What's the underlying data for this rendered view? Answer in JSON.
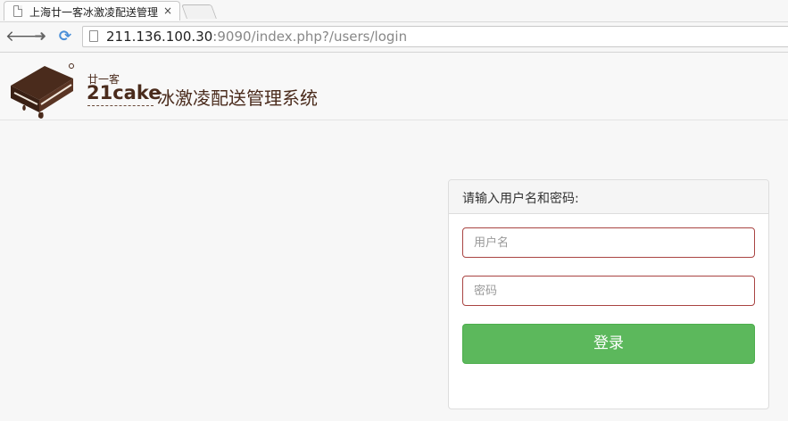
{
  "browser": {
    "tab_title": "上海廿一客冰激凌配送管理",
    "tab_close": "×",
    "url_host": "211.136.100.30",
    "url_rest": ":9090/index.php?/users/login",
    "back_glyph": "🡐",
    "forward_glyph": "➜",
    "reload_glyph": "⟳"
  },
  "header": {
    "brand_small": "廿一客",
    "brand_main": "21cake",
    "system_title": "冰激凌配送管理系统"
  },
  "login": {
    "heading": "请输入用户名和密码:",
    "username_placeholder": "用户名",
    "password_placeholder": "密码",
    "submit_label": "登录"
  },
  "colors": {
    "brand_brown": "#4a2b1c",
    "submit_green": "#5cb85c",
    "error_border": "#a94442"
  }
}
